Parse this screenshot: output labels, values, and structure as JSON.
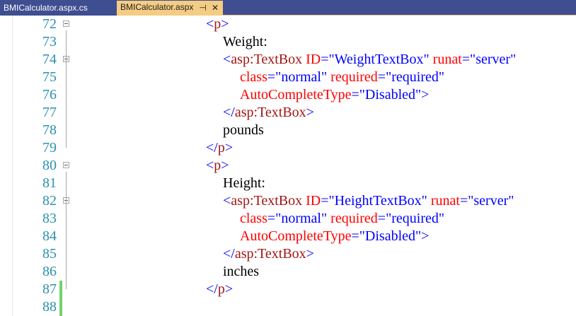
{
  "tabs": [
    {
      "label": "BMICalculator.aspx.cs",
      "active": false
    },
    {
      "label": "BMICalculator.aspx",
      "active": true
    }
  ],
  "tab_icons": {
    "pin": "⊣",
    "close": "✕"
  },
  "colors": {
    "tabbar_bg": "#3f4e91",
    "active_tab_bg": "#f5cc84",
    "line_number": "#2b91af",
    "punctuation": "#0000ff",
    "tag_name": "#a31515",
    "attribute": "#ff0000",
    "attribute_value": "#0000ff",
    "change_marker": "#71d36b"
  },
  "code_lines": [
    {
      "number": "72",
      "fold": true,
      "tokens": [
        [
          "punct",
          "<"
        ],
        [
          "tag",
          "p"
        ],
        [
          "punct",
          ">"
        ]
      ]
    },
    {
      "number": "73",
      "fold": false,
      "tokens": [
        [
          "text",
          "Weight:"
        ]
      ]
    },
    {
      "number": "74",
      "fold": true,
      "tokens": [
        [
          "punct",
          "<"
        ],
        [
          "tag",
          "asp:TextBox"
        ],
        [
          "text",
          " "
        ],
        [
          "attr",
          "ID"
        ],
        [
          "punct",
          "="
        ],
        [
          "val",
          "\"WeightTextBox\""
        ],
        [
          "text",
          " "
        ],
        [
          "attr",
          "runat"
        ],
        [
          "punct",
          "="
        ],
        [
          "val",
          "\"server\""
        ]
      ]
    },
    {
      "number": "75",
      "fold": false,
      "tokens": [
        [
          "attr",
          "class"
        ],
        [
          "punct",
          "="
        ],
        [
          "val",
          "\"normal\""
        ],
        [
          "text",
          " "
        ],
        [
          "attr",
          "required"
        ],
        [
          "punct",
          "="
        ],
        [
          "val",
          "\"required\""
        ]
      ]
    },
    {
      "number": "76",
      "fold": false,
      "tokens": [
        [
          "attr",
          "AutoCompleteType"
        ],
        [
          "punct",
          "="
        ],
        [
          "val",
          "\"Disabled\""
        ],
        [
          "punct",
          ">"
        ]
      ]
    },
    {
      "number": "77",
      "fold": false,
      "tokens": [
        [
          "punct",
          "</"
        ],
        [
          "tag",
          "asp:TextBox"
        ],
        [
          "punct",
          ">"
        ]
      ]
    },
    {
      "number": "78",
      "fold": false,
      "tokens": [
        [
          "text",
          "pounds"
        ]
      ]
    },
    {
      "number": "79",
      "fold": false,
      "tokens": [
        [
          "punct",
          "</"
        ],
        [
          "tag",
          "p"
        ],
        [
          "punct",
          ">"
        ]
      ]
    },
    {
      "number": "80",
      "fold": true,
      "tokens": [
        [
          "punct",
          "<"
        ],
        [
          "tag",
          "p"
        ],
        [
          "punct",
          ">"
        ]
      ]
    },
    {
      "number": "81",
      "fold": false,
      "tokens": [
        [
          "text",
          "Height:"
        ]
      ]
    },
    {
      "number": "82",
      "fold": true,
      "tokens": [
        [
          "punct",
          "<"
        ],
        [
          "tag",
          "asp:TextBox"
        ],
        [
          "text",
          " "
        ],
        [
          "attr",
          "ID"
        ],
        [
          "punct",
          "="
        ],
        [
          "val",
          "\"HeightTextBox\""
        ],
        [
          "text",
          " "
        ],
        [
          "attr",
          "runat"
        ],
        [
          "punct",
          "="
        ],
        [
          "val",
          "\"server\""
        ]
      ]
    },
    {
      "number": "83",
      "fold": false,
      "tokens": [
        [
          "attr",
          "class"
        ],
        [
          "punct",
          "="
        ],
        [
          "val",
          "\"normal\""
        ],
        [
          "text",
          " "
        ],
        [
          "attr",
          "required"
        ],
        [
          "punct",
          "="
        ],
        [
          "val",
          "\"required\""
        ]
      ]
    },
    {
      "number": "84",
      "fold": false,
      "tokens": [
        [
          "attr",
          "AutoCompleteType"
        ],
        [
          "punct",
          "="
        ],
        [
          "val",
          "\"Disabled\""
        ],
        [
          "punct",
          ">"
        ]
      ]
    },
    {
      "number": "85",
      "fold": false,
      "tokens": [
        [
          "punct",
          "</"
        ],
        [
          "tag",
          "asp:TextBox"
        ],
        [
          "punct",
          ">"
        ]
      ]
    },
    {
      "number": "86",
      "fold": false,
      "tokens": [
        [
          "text",
          "inches"
        ]
      ]
    },
    {
      "number": "87",
      "fold": false,
      "tokens": [
        [
          "punct",
          "</"
        ],
        [
          "tag",
          "p"
        ],
        [
          "punct",
          ">"
        ]
      ]
    },
    {
      "number": "88",
      "fold": false,
      "tokens": []
    }
  ]
}
